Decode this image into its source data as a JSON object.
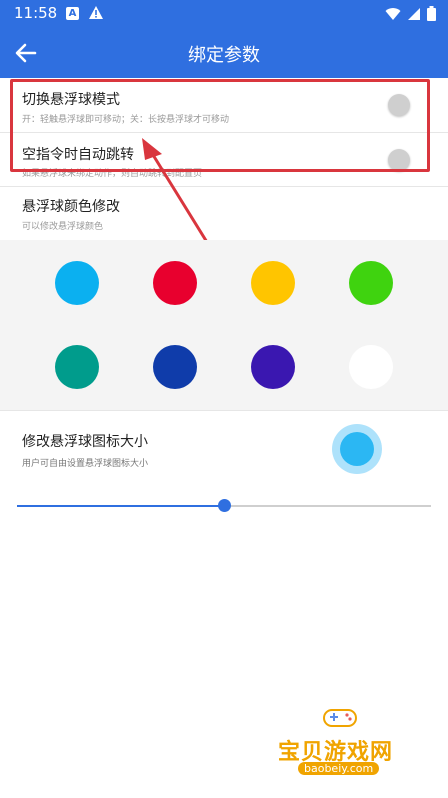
{
  "status_bar": {
    "time": "11:58",
    "icon_a_letter": "A"
  },
  "app_bar": {
    "title": "绑定参数"
  },
  "settings": [
    {
      "title": "切换悬浮球模式",
      "subtitle": "开：轻触悬浮球即可移动；关：长按悬浮球才可移动",
      "toggle_on": false
    },
    {
      "title": "空指令时自动跳转",
      "subtitle": "如果悬浮球未绑定动作，则自动跳转到配置页",
      "toggle_on": false
    },
    {
      "title": "悬浮球颜色修改",
      "subtitle": "可以修改悬浮球颜色"
    }
  ],
  "colors": [
    "#0bb0f0",
    "#e8002e",
    "#ffc500",
    "#3fd30f",
    "#009c8c",
    "#0f3caa",
    "#3a17b0",
    "#ffffff"
  ],
  "size_setting": {
    "title": "修改悬浮球图标大小",
    "subtitle": "用户可自由设置悬浮球图标大小",
    "slider_value_percent": 50
  },
  "accent_color": "#2f6fe0",
  "annotation_color": "#d9363e",
  "watermark": {
    "brand": "宝贝游戏网",
    "url": "baobeiy.com"
  }
}
